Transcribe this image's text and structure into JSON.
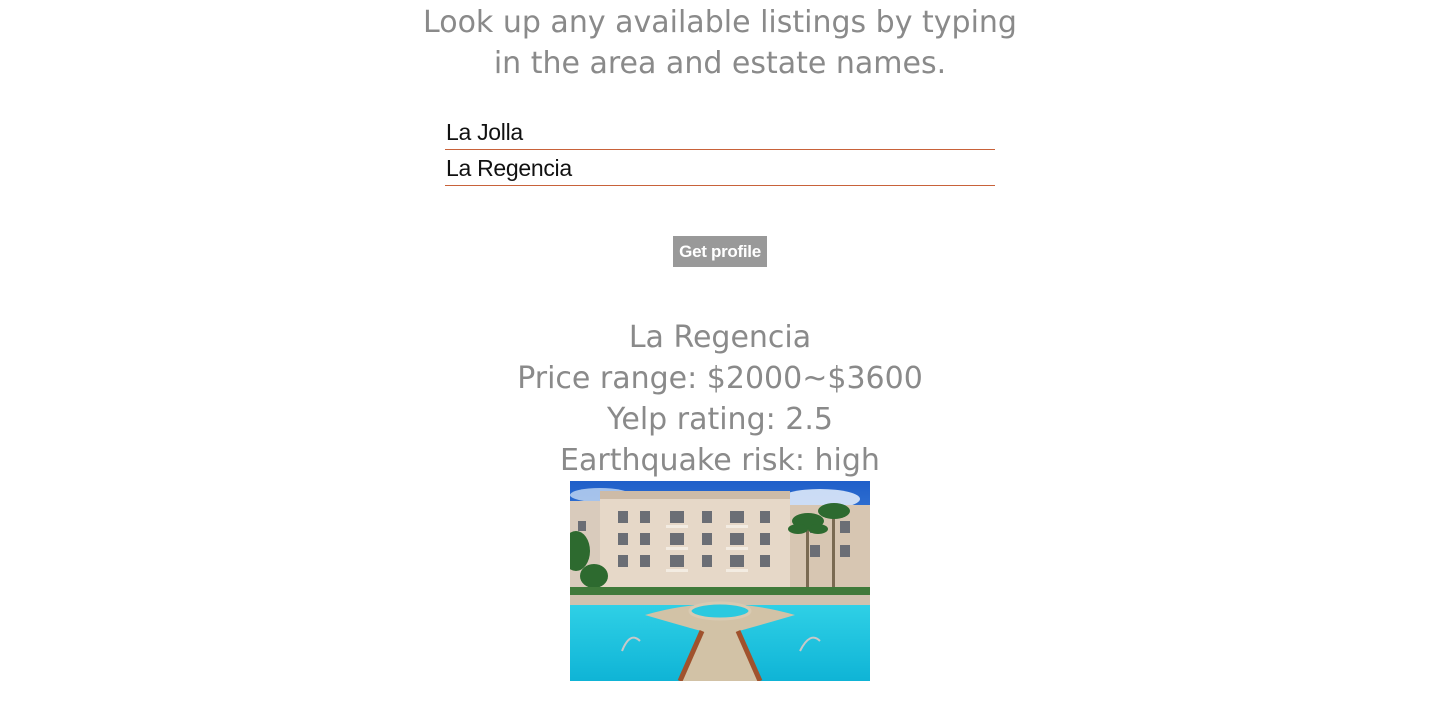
{
  "intro": {
    "line1": "Look up any available listings by typing",
    "line2": "in the area and estate names."
  },
  "form": {
    "area_value": "La Jolla",
    "estate_value": "La Regencia",
    "submit_label": "Get profile"
  },
  "profile": {
    "name": "La Regencia",
    "price_range": "Price range: $2000~$3600",
    "yelp_rating": "Yelp rating: 2.5",
    "earthquake_risk": "Earthquake risk: high"
  },
  "colors": {
    "text_gray": "#8a8a8a",
    "underline": "#c8623a",
    "button_bg": "#999999",
    "pool_water": "#19c3de"
  }
}
